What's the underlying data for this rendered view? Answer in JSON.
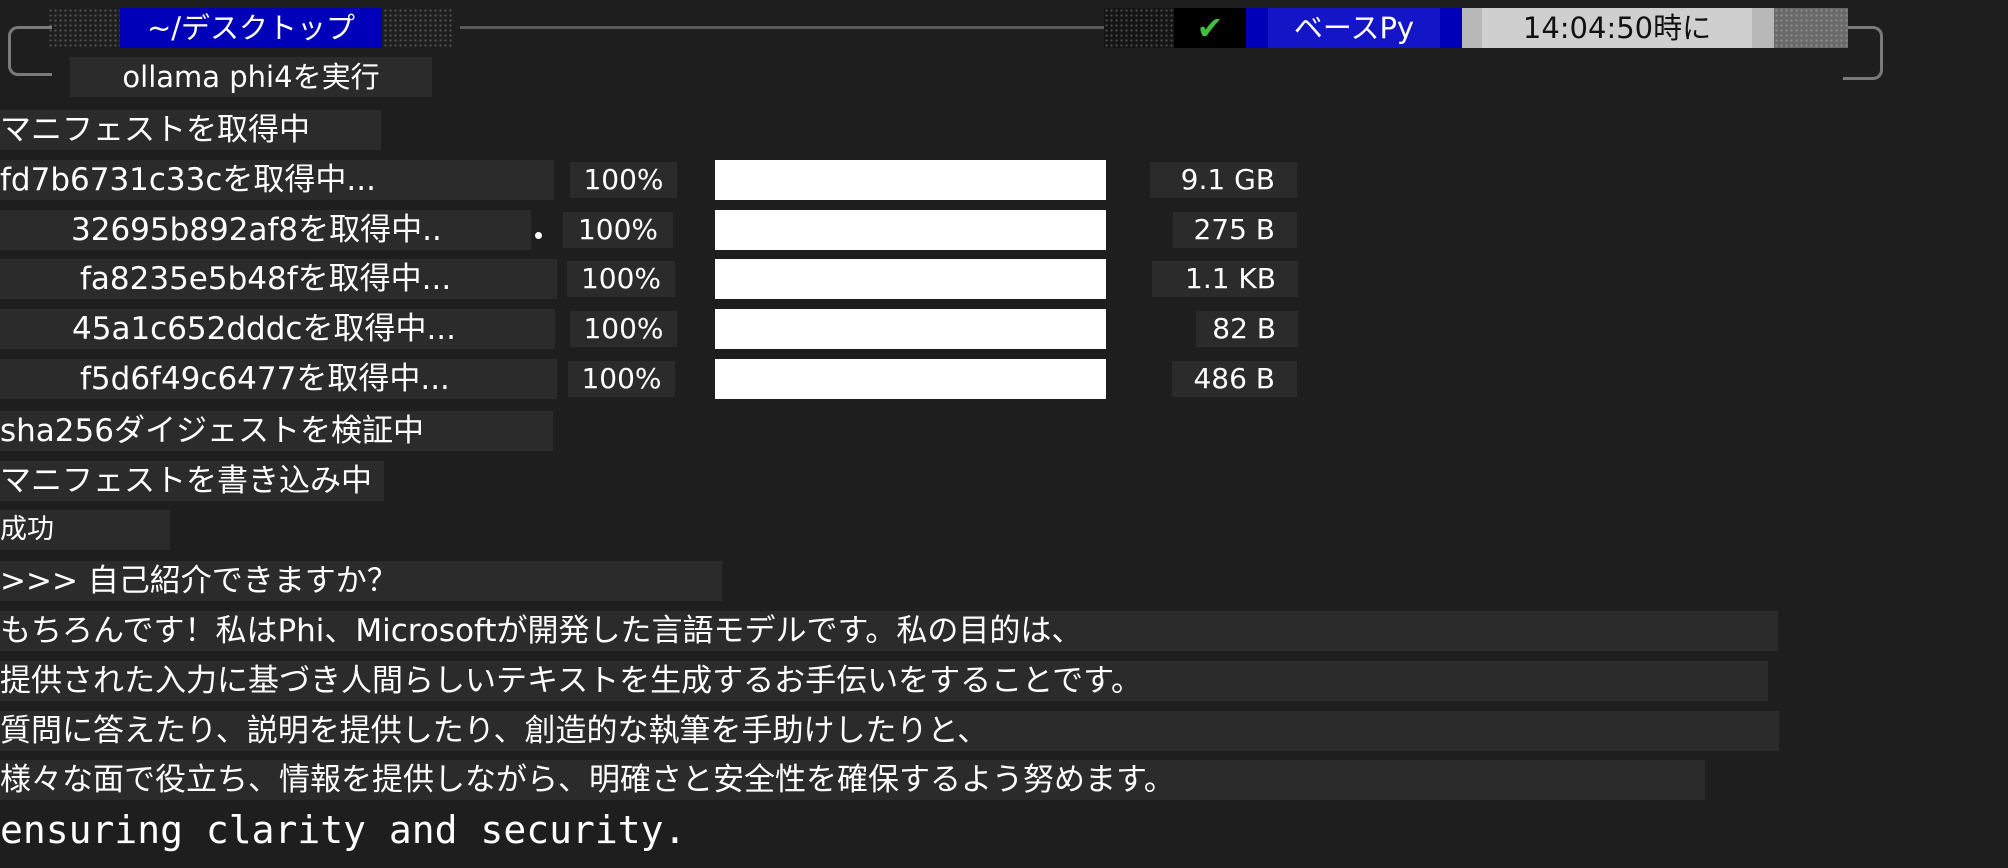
{
  "prompt_bar": {
    "directory": "~/デスクトップ",
    "status_icon": "check-icon",
    "status_glyph": "✔",
    "status_color": "#3fbf3f",
    "environment": "ベースPy",
    "time": "14:04:50時に"
  },
  "command": "ollama phi4を実行",
  "output": {
    "pulling_manifest": "マニフェストを取得中",
    "layers": [
      {
        "label": "fd7b6731c33cを取得中...",
        "percent": "100%",
        "progress": 1.0,
        "size": "9.1 GB"
      },
      {
        "label": "32695b892af8を取得中..",
        "percent": "100%",
        "progress": 1.0,
        "size": "275 B"
      },
      {
        "label": "fa8235e5b48fを取得中...",
        "percent": "100%",
        "progress": 1.0,
        "size": "1.1 KB"
      },
      {
        "label": "45a1c652dddcを取得中...",
        "percent": "100%",
        "progress": 1.0,
        "size": "82 B"
      },
      {
        "label": "f5d6f49c6477を取得中...",
        "percent": "100%",
        "progress": 1.0,
        "size": "486 B"
      }
    ],
    "verifying": "sha256ダイジェストを検証中",
    "writing_manifest": "マニフェストを書き込み中",
    "success": "成功"
  },
  "chat": {
    "user_prompt": ">>> 自己紹介できますか？",
    "response_lines": [
      "もちろんです！私はPhi、Microsoftが開発した言語モデルです。私の目的は、",
      "提供された入力に基づき人間らしいテキストを生成するお手伝いをすることです。",
      "質問に答えたり、説明を提供したり、創造的な執筆を手助けしたりと、",
      "様々な面で役立ち、情報を提供しながら、明確さと安全性を確保するよう努めます。"
    ],
    "trailing_line": "ensuring clarity and security."
  }
}
